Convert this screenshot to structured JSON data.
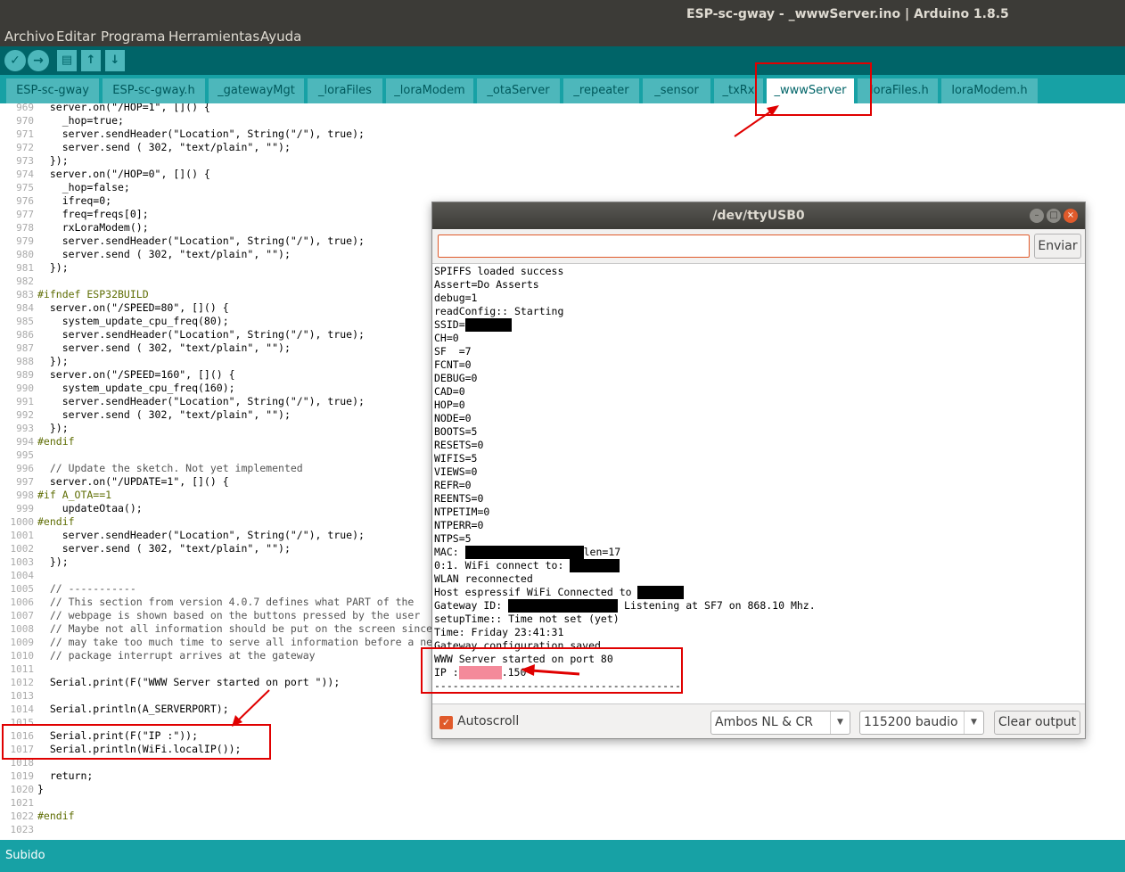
{
  "window": {
    "title": "ESP-sc-gway - _wwwServer.ino | Arduino 1.8.5"
  },
  "menu": [
    "Archivo",
    "Editar",
    "Programa",
    "Herramientas",
    "Ayuda"
  ],
  "toolbar": {
    "verify_icon": "checkmark-icon",
    "upload_icon": "arrow-right-icon",
    "new_icon": "document-icon",
    "open_icon": "arrow-up-icon",
    "save_icon": "arrow-down-icon"
  },
  "tabs": [
    "ESP-sc-gway",
    "ESP-sc-gway.h",
    "_gatewayMgt",
    "_loraFiles",
    "_loraModem",
    "_otaServer",
    "_repeater",
    "_sensor",
    "_txRx",
    "_wwwServer",
    "loraFiles.h",
    "loraModem.h"
  ],
  "active_tab": "_wwwServer",
  "editor": {
    "line_numbers": [
      "969",
      "970",
      "971",
      "972",
      "973",
      "974",
      "975",
      "976",
      "977",
      "978",
      "979",
      "980",
      "981",
      "982",
      "983",
      "984",
      "985",
      "986",
      "987",
      "988",
      "989",
      "990",
      "991",
      "992",
      "993",
      "994",
      "995",
      "996",
      "997",
      "998",
      "999",
      "1000",
      "1001",
      "1002",
      "1003",
      "1004",
      "1005",
      "1006",
      "1007",
      "1008",
      "1009",
      "1010",
      "1011",
      "1012",
      "1013",
      "1014",
      "1015",
      "1016",
      "1017",
      "1018",
      "1019",
      "1020",
      "1021",
      "1022",
      "1023"
    ],
    "lines": [
      "  server.on(\"/HOP=1\", []() {",
      "    _hop=true;",
      "    server.sendHeader(\"Location\", String(\"/\"), true);",
      "    server.send ( 302, \"text/plain\", \"\");",
      "  });",
      "  server.on(\"/HOP=0\", []() {",
      "    _hop=false;",
      "    ifreq=0;",
      "    freq=freqs[0];",
      "    rxLoraModem();",
      "    server.sendHeader(\"Location\", String(\"/\"), true);",
      "    server.send ( 302, \"text/plain\", \"\");",
      "  });",
      "",
      "#ifndef ESP32BUILD",
      "  server.on(\"/SPEED=80\", []() {",
      "    system_update_cpu_freq(80);",
      "    server.sendHeader(\"Location\", String(\"/\"), true);",
      "    server.send ( 302, \"text/plain\", \"\");",
      "  });",
      "  server.on(\"/SPEED=160\", []() {",
      "    system_update_cpu_freq(160);",
      "    server.sendHeader(\"Location\", String(\"/\"), true);",
      "    server.send ( 302, \"text/plain\", \"\");",
      "  });",
      "#endif",
      "",
      "  // Update the sketch. Not yet implemented",
      "  server.on(\"/UPDATE=1\", []() {",
      "#if A_OTA==1",
      "    updateOtaa();",
      "#endif",
      "    server.sendHeader(\"Location\", String(\"/\"), true);",
      "    server.send ( 302, \"text/plain\", \"\");",
      "  });",
      "",
      "  // -----------",
      "  // This section from version 4.0.7 defines what PART of the",
      "  // webpage is shown based on the buttons pressed by the user",
      "  // Maybe not all information should be put on the screen since it",
      "  // may take too much time to serve all information before a next",
      "  // package interrupt arrives at the gateway",
      "",
      "  Serial.print(F(\"WWW Server started on port \"));",
      "",
      "  Serial.println(A_SERVERPORT);",
      "",
      "  Serial.print(F(\"IP :\"));",
      "  Serial.println(WiFi.localIP());",
      "",
      "  return;",
      "}",
      "",
      "#endif",
      ""
    ]
  },
  "serial_monitor": {
    "title": "/dev/ttyUSB0",
    "input_value": "",
    "send_label": "Enviar",
    "output": [
      "SPIFFS loaded success",
      "Assert=Do Asserts",
      "debug=1",
      "readConfig:: Starting",
      "SSID=",
      "CH=0",
      "SF  =7",
      "FCNT=0",
      "DEBUG=0",
      "CAD=0",
      "HOP=0",
      "NODE=0",
      "BOOTS=5",
      "RESETS=0",
      "WIFIS=5",
      "VIEWS=0",
      "REFR=0",
      "REENTS=0",
      "NTPETIM=0",
      "NTPERR=0",
      "NTPS=5",
      "MAC: ",
      "0:1. WiFi connect to: ",
      "WLAN reconnected",
      "Host espressif WiFi Connected to ",
      "Gateway ID: ",
      "setupTime:: Time not set (yet)",
      "Time: Friday 23:41:31",
      "Gateway configuration saved",
      "WWW Server started on port 80",
      "IP :",
      "----------------------------------------"
    ],
    "mac_suffix": "len=17",
    "gateway_suffix": " Listening at SF7 on 868.10 Mhz.",
    "ip_suffix": ".150",
    "autoscroll_label": "Autoscroll",
    "autoscroll_checked": true,
    "line_ending": "Ambos NL & CR",
    "baud": "115200 baudio",
    "clear_label": "Clear output"
  },
  "status": {
    "text": "Subido"
  },
  "colors": {
    "annotation": "#e00000",
    "teal_dark": "#006468",
    "teal": "#17a1a5"
  }
}
